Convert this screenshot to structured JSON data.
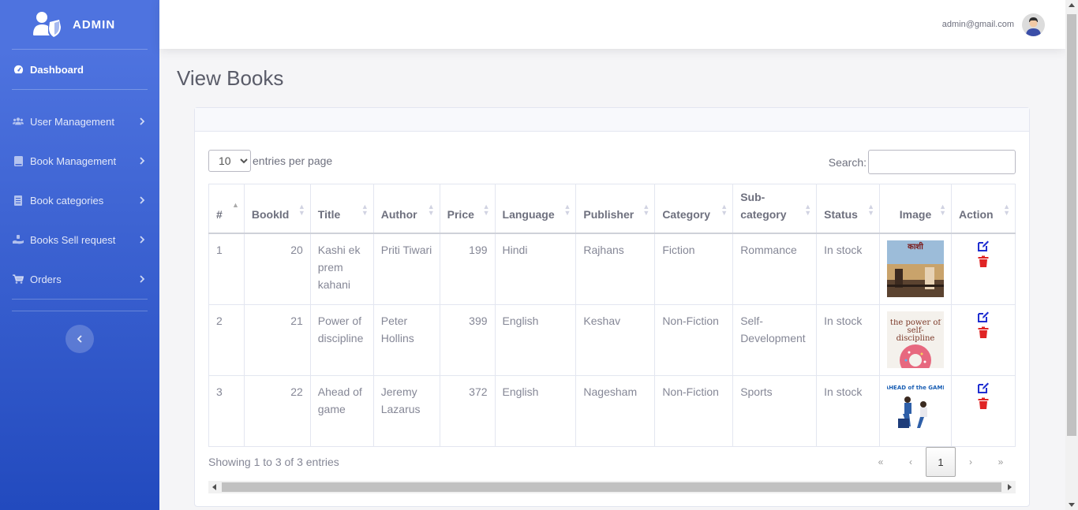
{
  "brand": {
    "name": "ADMIN"
  },
  "sidebar": {
    "items": [
      {
        "label": "Dashboard",
        "icon": "tachometer-icon"
      },
      {
        "label": "User Management",
        "icon": "users-icon"
      },
      {
        "label": "Book Management",
        "icon": "book-icon"
      },
      {
        "label": "Book categories",
        "icon": "list-icon"
      },
      {
        "label": "Books Sell request",
        "icon": "hand-holding-icon"
      },
      {
        "label": "Orders",
        "icon": "cart-icon"
      }
    ]
  },
  "topbar": {
    "user_email": "admin@gmail.com"
  },
  "page": {
    "title": "View Books"
  },
  "table_controls": {
    "entries_value": "10",
    "entries_label": "entries per page",
    "search_label": "Search:"
  },
  "table": {
    "headers": [
      "#",
      "BookId",
      "Title",
      "Author",
      "Price",
      "Language",
      "Publisher",
      "Category",
      "Sub-category",
      "Status",
      "Image",
      "Action"
    ],
    "rows": [
      {
        "index": "1",
        "book_id": "20",
        "title": "Kashi ek prem kahani",
        "author": "Priti Tiwari",
        "price": "199",
        "language": "Hindi",
        "publisher": "Rajhans",
        "category": "Fiction",
        "subcategory": "Rommance",
        "status": "In stock",
        "image_text": "काशी"
      },
      {
        "index": "2",
        "book_id": "21",
        "title": "Power of discipline",
        "author": "Peter Hollins",
        "price": "399",
        "language": "English",
        "publisher": "Keshav",
        "category": "Non-Fiction",
        "subcategory": "Self-Development",
        "status": "In stock",
        "image_text": "the power of self-discipline"
      },
      {
        "index": "3",
        "book_id": "22",
        "title": "Ahead of game",
        "author": "Jeremy Lazarus",
        "price": "372",
        "language": "English",
        "publisher": "Nagesham",
        "category": "Non-Fiction",
        "subcategory": "Sports",
        "status": "In stock",
        "image_text": "AHEAD of the GAME"
      }
    ]
  },
  "footer": {
    "showing": "Showing 1 to 3 of 3 entries",
    "pagination": {
      "first": "«",
      "prev": "‹",
      "current": "1",
      "next": "›",
      "last": "»"
    }
  },
  "colors": {
    "sidebar_top": "#4e73df",
    "sidebar_bottom": "#224abe",
    "edit": "#1f2ed1",
    "delete": "#e02424"
  }
}
